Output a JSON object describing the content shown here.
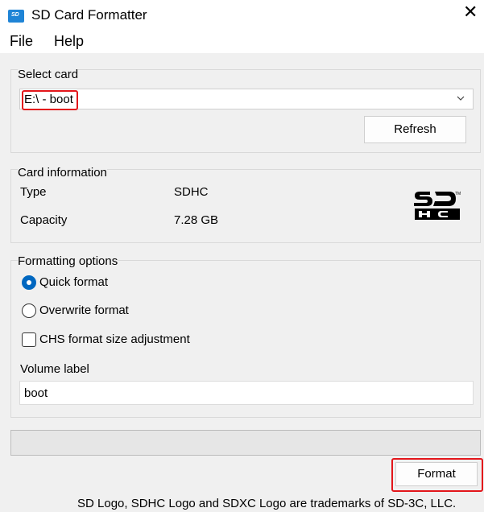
{
  "window": {
    "title": "SD Card Formatter",
    "icon_text": "SD"
  },
  "menu": {
    "items": [
      "File",
      "Help"
    ]
  },
  "select_card": {
    "group_title": "Select card",
    "selected": "E:\\ - boot",
    "refresh_label": "Refresh"
  },
  "card_info": {
    "group_title": "Card information",
    "type_label": "Type",
    "type_value": "SDHC",
    "capacity_label": "Capacity",
    "capacity_value": "7.28 GB",
    "logo_icon": "sdhc-logo-icon"
  },
  "formatting": {
    "group_title": "Formatting options",
    "quick_label": "Quick format",
    "overwrite_label": "Overwrite format",
    "selected_option": "Quick format",
    "chs_label": "CHS format size adjustment",
    "chs_checked": false,
    "volume_label_title": "Volume label",
    "volume_label_value": "boot"
  },
  "progress": {
    "fraction": 0
  },
  "actions": {
    "format_label": "Format"
  },
  "footer": {
    "text": "SD Logo, SDHC Logo and SDXC Logo are trademarks of SD-3C, LLC."
  },
  "colors": {
    "accent": "#0067c0",
    "highlight_red": "#e3161b",
    "background": "#f0f0f0"
  }
}
